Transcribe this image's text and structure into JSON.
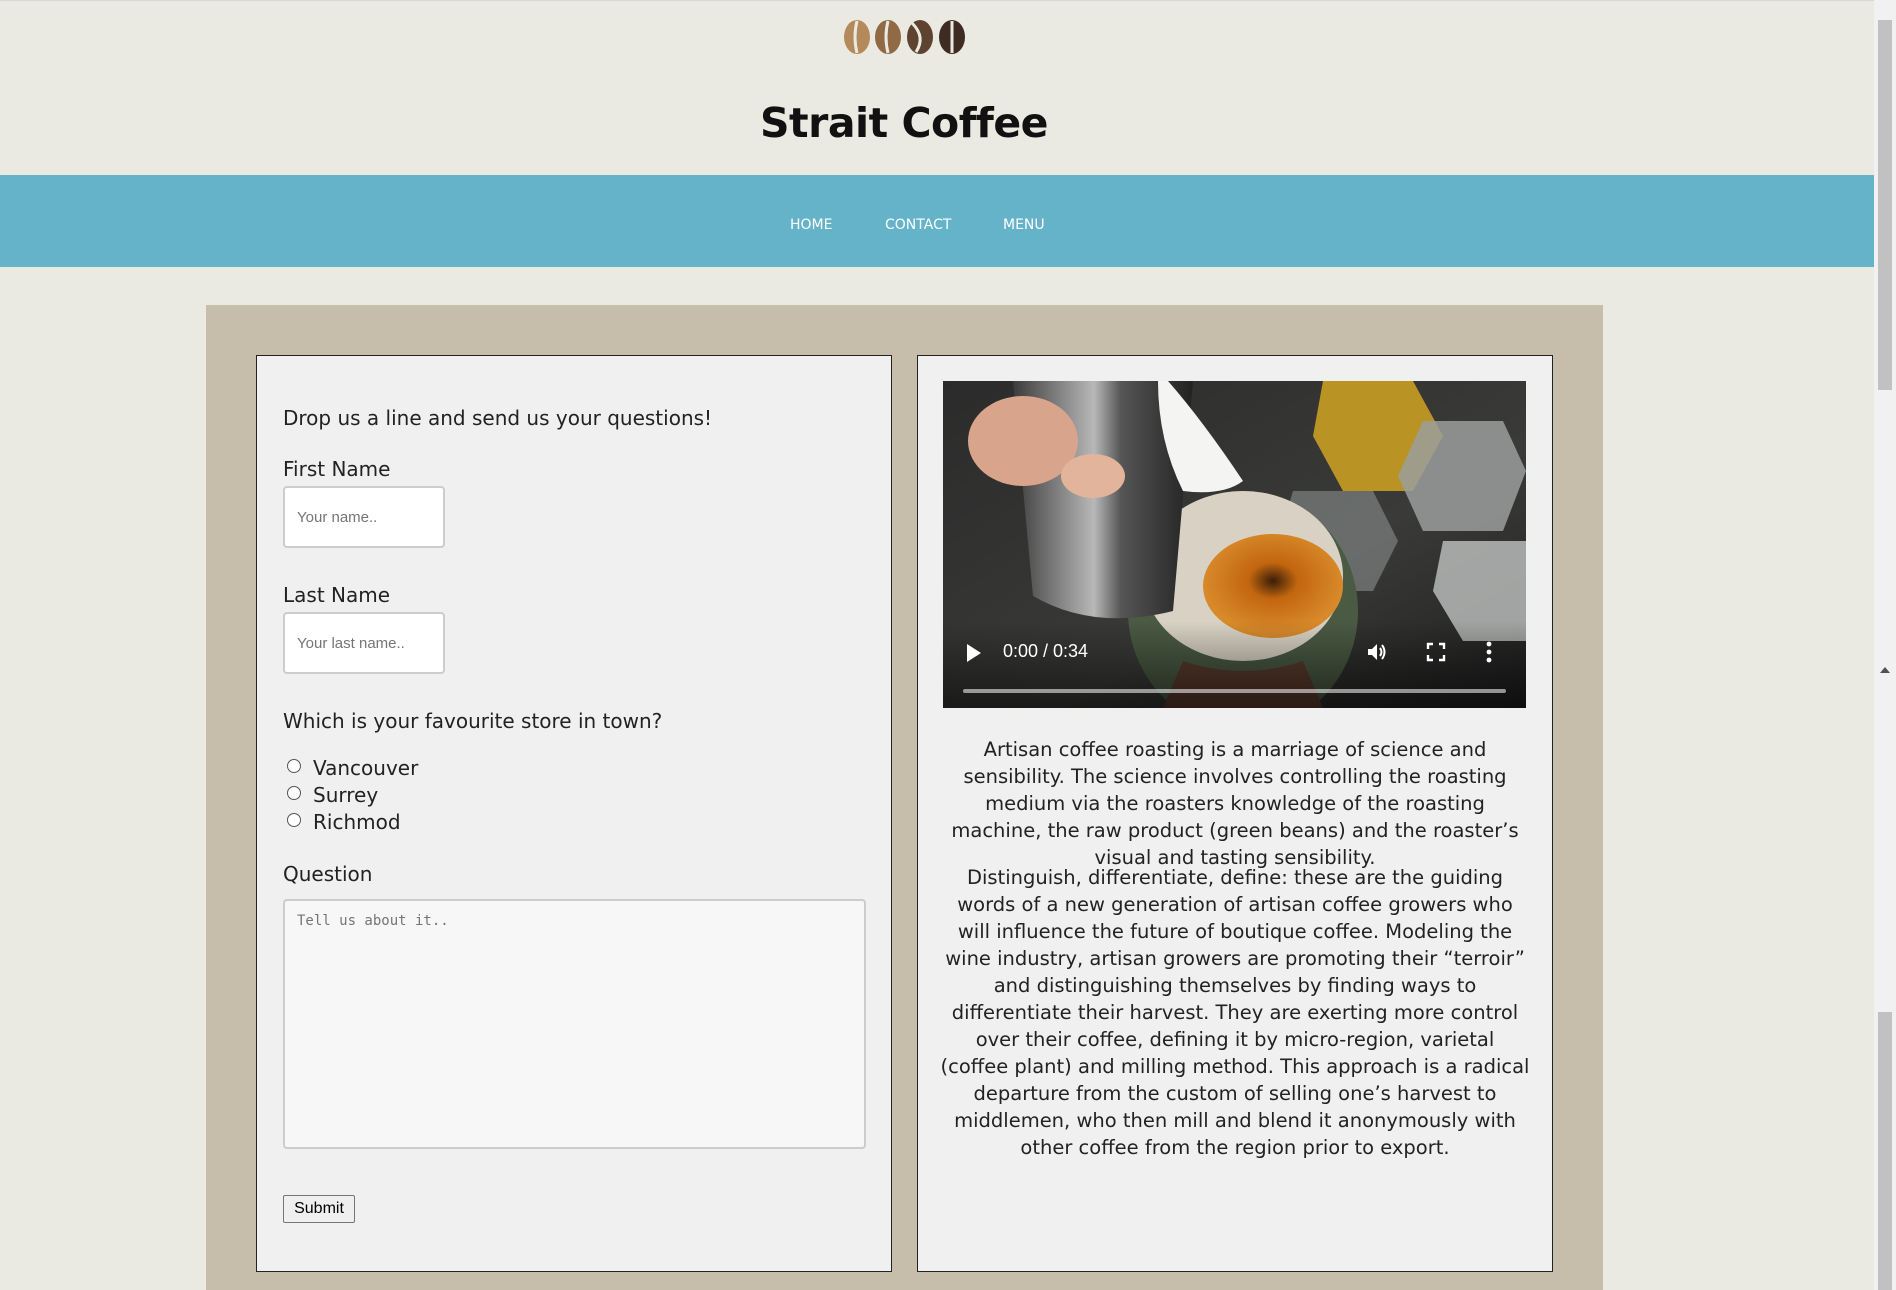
{
  "header": {
    "title": "Strait Coffee",
    "logo_icon": "coffee-beans-logo"
  },
  "nav": {
    "items": [
      {
        "label": "HOME"
      },
      {
        "label": "CONTACT"
      },
      {
        "label": "MENU"
      }
    ]
  },
  "form": {
    "intro": "Drop us a line and send us your questions!",
    "first_name_label": "First Name",
    "first_name_placeholder": "Your name..",
    "first_name_value": "",
    "last_name_label": "Last Name",
    "last_name_placeholder": "Your last name..",
    "last_name_value": "",
    "store_question": "Which is your favourite store in town?",
    "stores": [
      "Vancouver",
      "Surrey",
      "Richmod"
    ],
    "selected_store": null,
    "question_label": "Question",
    "question_placeholder": "Tell us about it..",
    "submit_label": "Submit"
  },
  "video": {
    "time": "0:00 / 0:34",
    "progress": 0
  },
  "article": {
    "paragraphs": [
      "Artisan coffee roasting is a marriage of science and sensibility. The science involves controlling the roasting medium via the roasters knowledge of the roasting machine, the raw product (green beans) and the roaster’s visual and tasting sensibility.",
      "Distinguish, differentiate, define: these are the guiding words of a new generation of artisan coffee growers who will influence the future of boutique coffee. Modeling the wine industry, artisan growers are promoting their “terroir” and distinguishing themselves by finding ways to differentiate their harvest. They are exerting more control over their coffee, defining it by micro-region, varietal (coffee plant) and milling method. This approach is a radical departure from the custom of selling one’s harvest to middlemen, who then mill and blend it anonymously with other coffee from the region prior to export."
    ]
  },
  "colors": {
    "page_bg": "#ebeae2",
    "nav_bg": "#64b3c9",
    "content_bg": "#c7bdab",
    "panel_bg": "#f0f0f0"
  }
}
